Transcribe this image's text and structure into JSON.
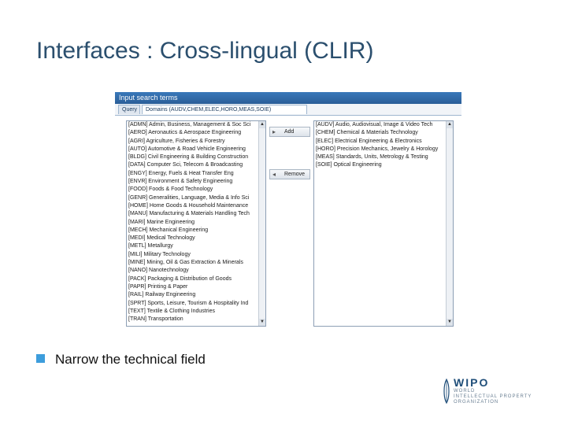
{
  "slide": {
    "title": "Interfaces : Cross-lingual (CLIR)",
    "bullet": "Narrow the technical field"
  },
  "window": {
    "header": "Input search terms",
    "tabs": [
      {
        "label": "Query"
      },
      {
        "label": "Domains (AUDV,CHEM,ELEC,HORO,MEAS,SOIE)"
      }
    ]
  },
  "domains": {
    "available": [
      "[ADMN] Admin, Business, Management & Soc Sci",
      "[AERO] Aeronautics & Aerospace Engineering",
      "[AGRI] Agriculture, Fisheries & Forestry",
      "[AUTO] Automotive & Road Vehicle Engineering",
      "[BLDG] Civil Engineering & Building Construction",
      "[DATA] Computer Sci, Telecom & Broadcasting",
      "[ENGY] Energy, Fuels & Heat Transfer Eng",
      "[ENVR] Environment & Safety Engineering",
      "[FOOD] Foods & Food Technology",
      "[GENR] Generalities, Language, Media & Info Sci",
      "[HOME] Home Goods & Household Maintenance",
      "[MANU] Manufacturing & Materials Handling Tech",
      "[MARI] Marine Engineering",
      "[MECH] Mechanical Engineering",
      "[MEDI] Medical Technology",
      "[METL] Metallurgy",
      "[MILI] Military Technology",
      "[MINE] Mining, Oil & Gas Extraction & Minerals",
      "[NANO] Nanotechnology",
      "[PACK] Packaging & Distribution of Goods",
      "[PAPR] Printing & Paper",
      "[RAIL] Railway Engineering",
      "[SPRT] Sports, Leisure, Tourism & Hospitality Ind",
      "[TEXT] Textile & Clothing Industries",
      "[TRAN] Transportation"
    ],
    "selected": [
      "[AUDV] Audio, Audiovisual, Image & Video Tech",
      "[CHEM] Chemical & Materials Technology",
      "[ELEC] Electrical Engineering & Electronics",
      "[HORO] Precision Mechanics, Jewelry & Horology",
      "[MEAS] Standards, Units, Metrology & Testing",
      "[SOIE] Optical Engineering"
    ],
    "add_label": "Add",
    "remove_label": "Remove"
  },
  "logo": {
    "main": "WIPO",
    "line1": "WORLD",
    "line2": "INTELLECTUAL PROPERTY",
    "line3": "ORGANIZATION"
  },
  "colors": {
    "title": "#2b4f6e",
    "bullet": "#3d9ddc",
    "window_header": "#2a5e98",
    "logo": "#1f4e79"
  }
}
